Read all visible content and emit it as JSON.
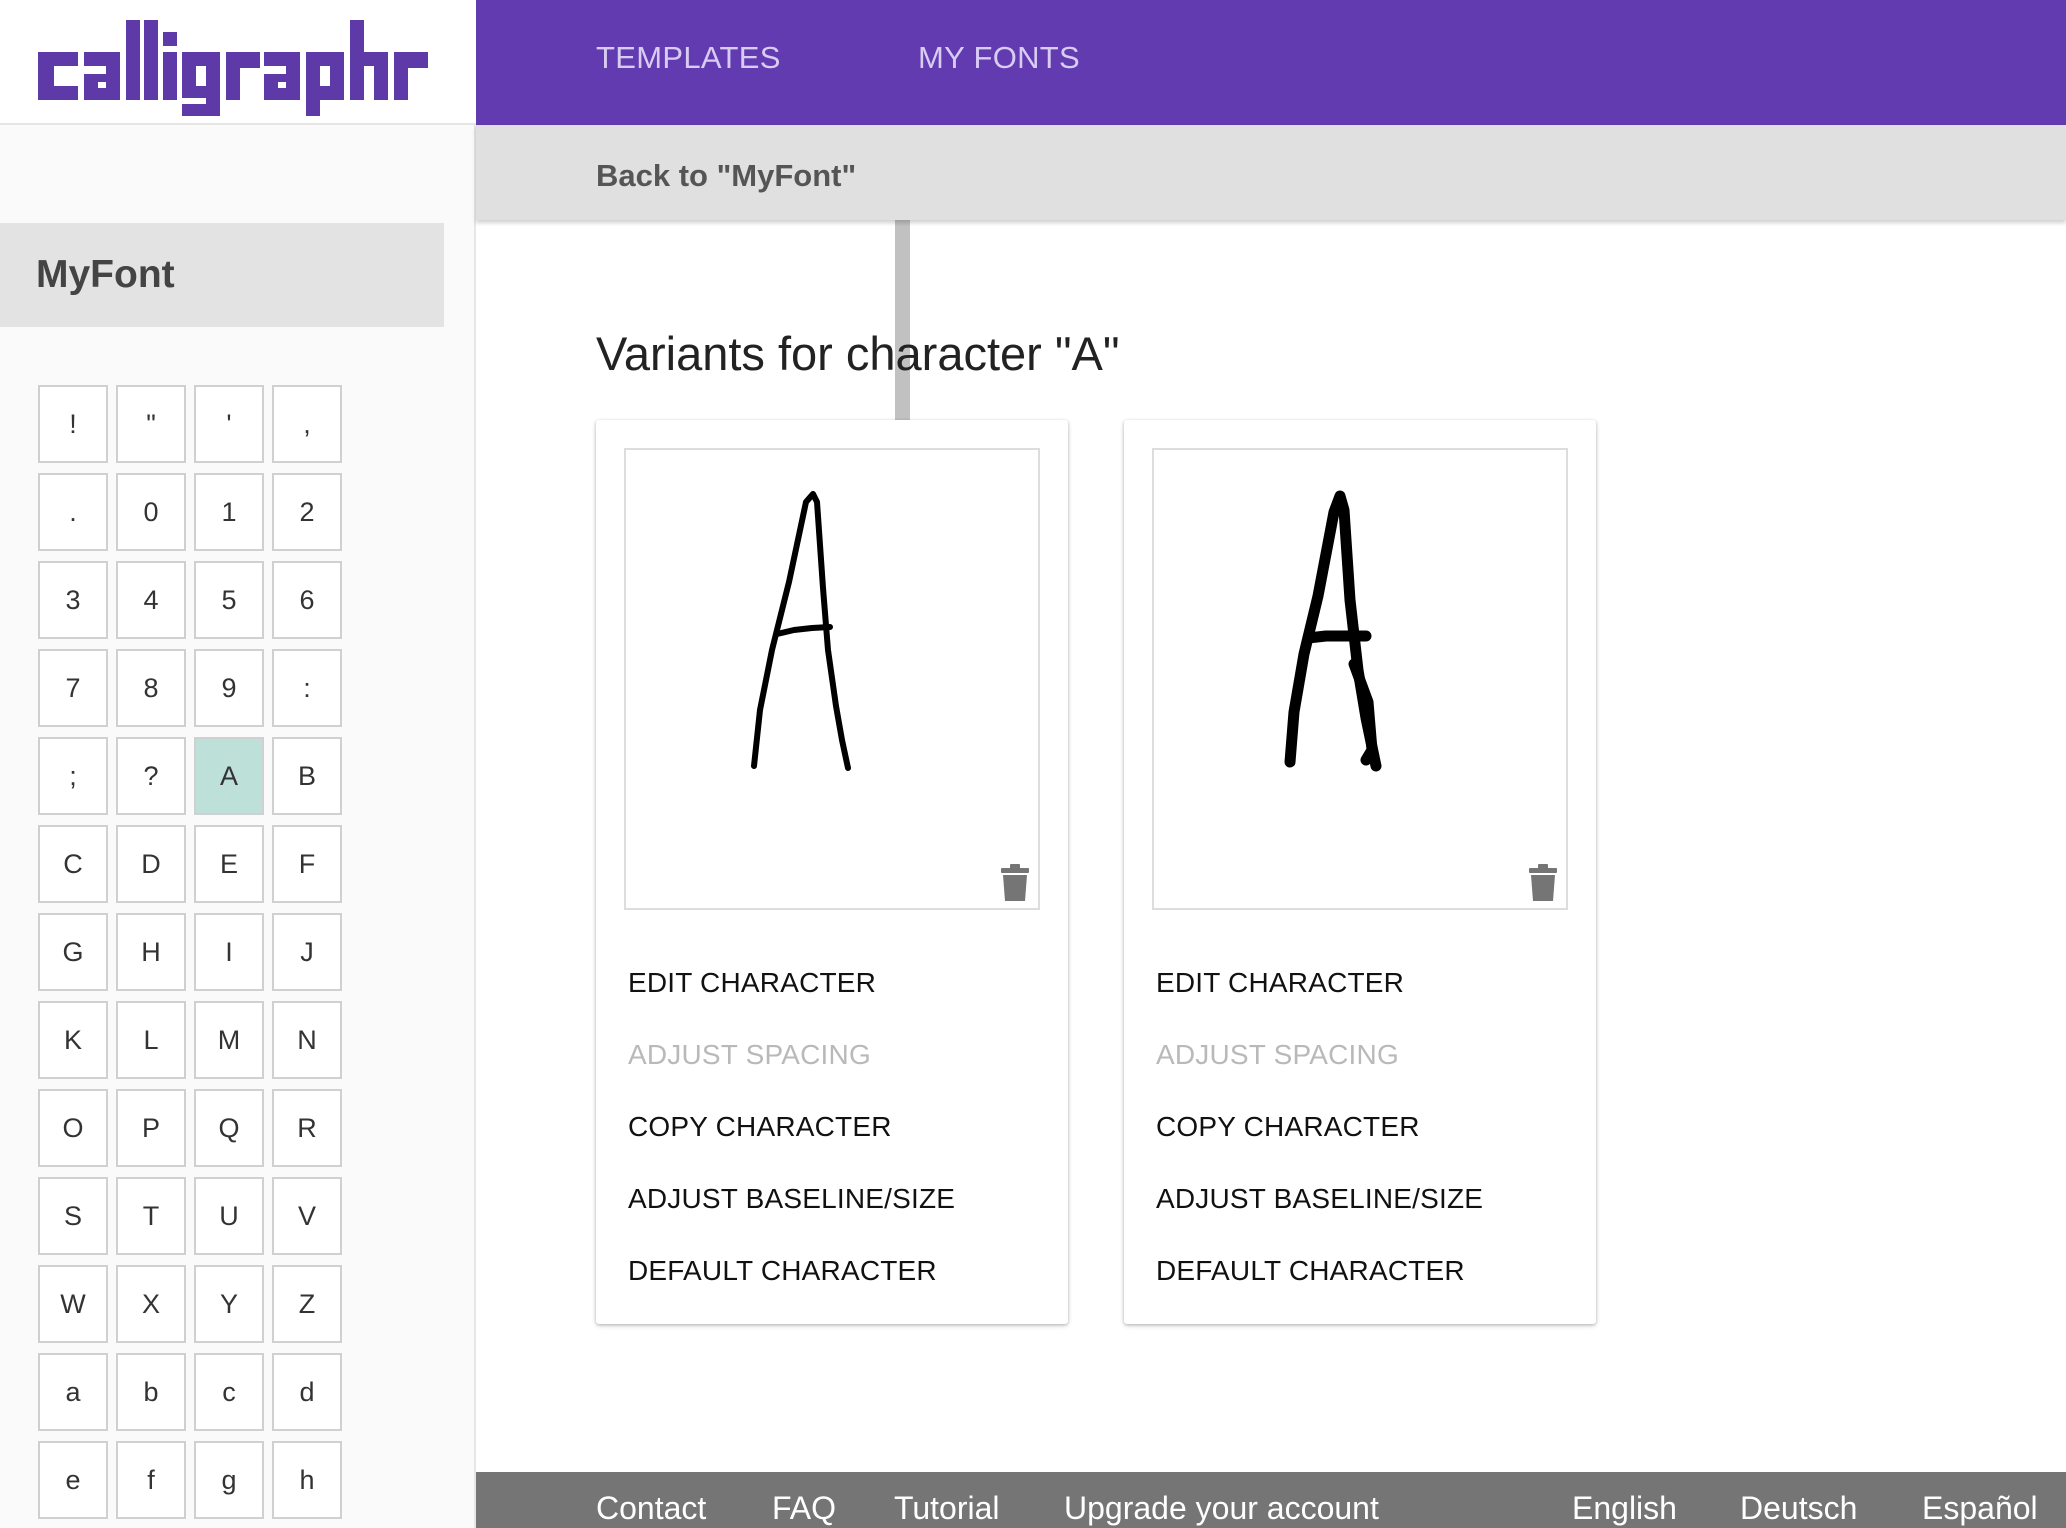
{
  "logo": {
    "text": "calligraphr"
  },
  "topnav": {
    "templates": "TEMPLATES",
    "my_fonts": "MY FONTS"
  },
  "subheader": {
    "back": "Back to \"MyFont\""
  },
  "sidebar": {
    "font_name": "MyFont",
    "characters": [
      "!",
      "\"",
      "'",
      ",",
      ".",
      "0",
      "1",
      "2",
      "3",
      "4",
      "5",
      "6",
      "7",
      "8",
      "9",
      ":",
      ";",
      "?",
      "A",
      "B",
      "C",
      "D",
      "E",
      "F",
      "G",
      "H",
      "I",
      "J",
      "K",
      "L",
      "M",
      "N",
      "O",
      "P",
      "Q",
      "R",
      "S",
      "T",
      "U",
      "V",
      "W",
      "X",
      "Y",
      "Z",
      "a",
      "b",
      "c",
      "d",
      "e",
      "f",
      "g",
      "h"
    ],
    "selected": "A"
  },
  "main": {
    "heading": "Variants for character \"A\"",
    "variants": [
      {
        "glyph": "A",
        "actions": {
          "edit": "EDIT CHARACTER",
          "spacing": "ADJUST SPACING",
          "copy": "COPY CHARACTER",
          "baseline": "ADJUST BASELINE/SIZE",
          "default": "DEFAULT CHARACTER"
        }
      },
      {
        "glyph": "A",
        "actions": {
          "edit": "EDIT CHARACTER",
          "spacing": "ADJUST SPACING",
          "copy": "COPY CHARACTER",
          "baseline": "ADJUST BASELINE/SIZE",
          "default": "DEFAULT CHARACTER"
        }
      }
    ]
  },
  "footer": {
    "contact": "Contact",
    "faq": "FAQ",
    "tutorial": "Tutorial",
    "upgrade": "Upgrade your account",
    "english": "English",
    "deutsch": "Deutsch",
    "espanol": "Español"
  },
  "colors": {
    "brand_purple": "#623bb0",
    "selected_cell": "#bde0d8",
    "footer_gray": "#757575",
    "disabled_text": "#b9b9b9"
  },
  "icons": [
    "calligraphr-logo",
    "trash-icon"
  ]
}
